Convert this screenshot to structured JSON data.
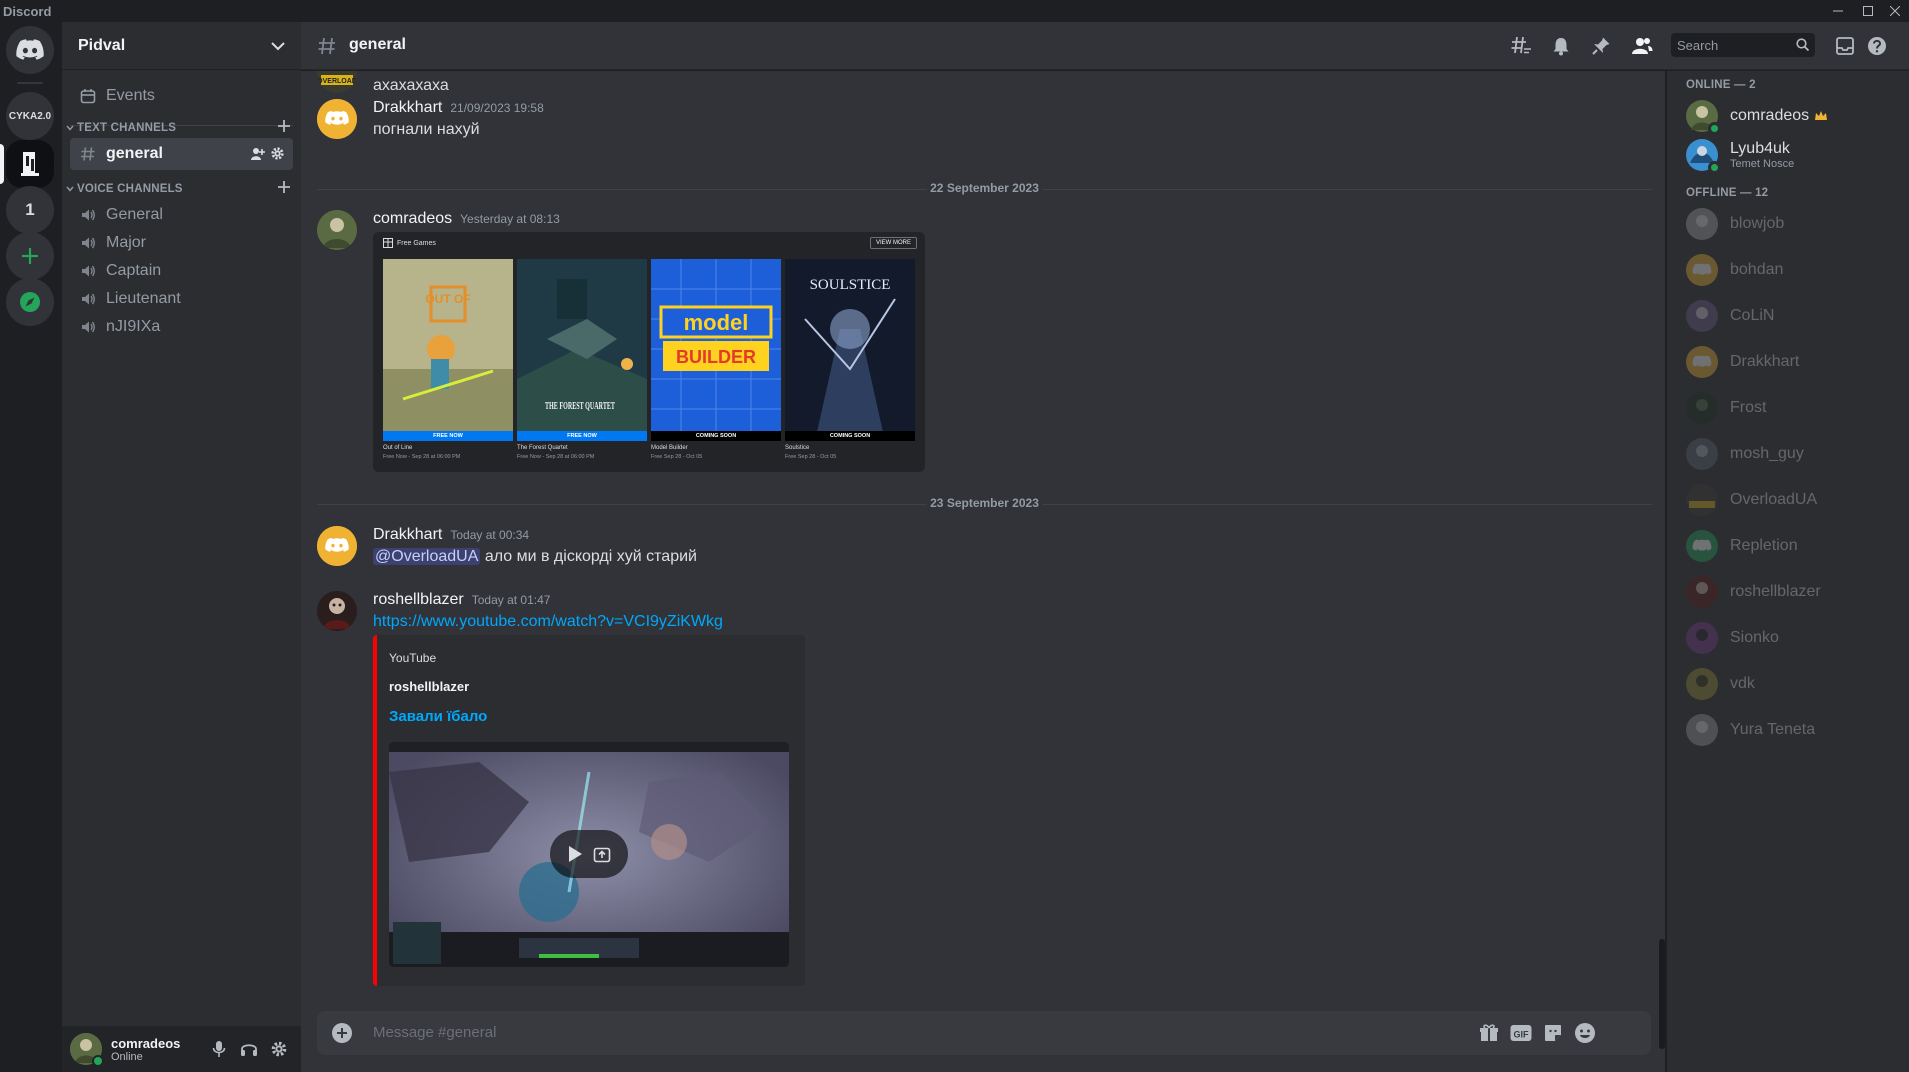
{
  "app": {
    "title": "Discord"
  },
  "colors": {
    "accent": "#5865f2",
    "online": "#23a55a",
    "link": "#00a8fc",
    "youtube": "#ff0000"
  },
  "rail": {
    "servers": [
      {
        "label": "",
        "icon": "discord-home-icon"
      },
      {
        "label": "CYKA2.0"
      },
      {
        "label": "",
        "icon": "server-logo-icon",
        "active": true
      },
      {
        "label": "1"
      },
      {
        "label": "",
        "icon": "add-server-icon"
      },
      {
        "label": "",
        "icon": "explore-compass-icon"
      }
    ]
  },
  "sidebar": {
    "guild_name": "Pidval",
    "events_label": "Events",
    "text_category": "TEXT CHANNELS",
    "text_channels": [
      {
        "name": "general",
        "active": true
      }
    ],
    "voice_category": "VOICE CHANNELS",
    "voice_channels": [
      {
        "name": "General"
      },
      {
        "name": "Major"
      },
      {
        "name": "Captain"
      },
      {
        "name": "Lieutenant"
      },
      {
        "name": "nJI9IXa"
      }
    ]
  },
  "user_panel": {
    "name": "comradeos",
    "status": "Online"
  },
  "header": {
    "channel": "general",
    "search_placeholder": "Search"
  },
  "messages": [
    {
      "author_partial": "",
      "text": "ахахахаха"
    },
    {
      "author": "Drakkhart",
      "timestamp": "21/09/2023 19:58",
      "text": "погнали нахуй"
    },
    {
      "author": "comradeos",
      "timestamp": "Yesterday at 08:13"
    },
    {
      "author": "Drakkhart",
      "timestamp": "Today at 00:34",
      "mention": "@OverloadUA",
      "text": "ало ми в діскорді хуй старий"
    },
    {
      "author": "roshellblazer",
      "timestamp": "Today at 01:47",
      "link": "https://www.youtube.com/watch?v=VCI9yZiKWkg"
    }
  ],
  "date_dividers": [
    "22 September 2023",
    "23 September 2023"
  ],
  "free_games_embed": {
    "header": "Free Games",
    "view_more": "VIEW MORE",
    "games": [
      {
        "title": "Out of Line",
        "band": "FREE NOW",
        "sub": "Free Now - Sep 28 at 06:00 PM",
        "band_color": "#0078f2"
      },
      {
        "title": "The Forest Quartet",
        "band": "FREE NOW",
        "sub": "Free Now - Sep 28 at 06:00 PM",
        "band_color": "#0078f2"
      },
      {
        "title": "Model Builder",
        "band": "COMING SOON",
        "sub": "Free Sep 28 - Oct 05",
        "band_color": "#000000"
      },
      {
        "title": "Soulstice",
        "band": "COMING SOON",
        "sub": "Free Sep 28 - Oct 05",
        "band_color": "#000000"
      }
    ],
    "art_text": {
      "out_of_line": "OUT OF",
      "forest_quartet": "THE FOREST QUARTET",
      "model_top": "model",
      "model_bottom": "BUILDER",
      "soulstice": "SOULSTICE",
      "overload": "OVERLOAD"
    }
  },
  "youtube_embed": {
    "provider": "YouTube",
    "author": "roshellblazer",
    "title": "Завали їбало"
  },
  "composer": {
    "placeholder": "Message #general"
  },
  "members": {
    "online_header": "ONLINE — 2",
    "online": [
      {
        "name": "comradeos",
        "crown": true
      },
      {
        "name": "Lyub4uk",
        "activity": "Temet Nosce"
      }
    ],
    "offline_header": "OFFLINE — 12",
    "offline": [
      {
        "name": "blowjob"
      },
      {
        "name": "bohdan"
      },
      {
        "name": "CoLiN"
      },
      {
        "name": "Drakkhart"
      },
      {
        "name": "Frost"
      },
      {
        "name": "mosh_guy"
      },
      {
        "name": "OverloadUA"
      },
      {
        "name": "Repletion"
      },
      {
        "name": "roshellblazer"
      },
      {
        "name": "Sionko"
      },
      {
        "name": "vdk"
      },
      {
        "name": "Yura Teneta"
      }
    ]
  }
}
